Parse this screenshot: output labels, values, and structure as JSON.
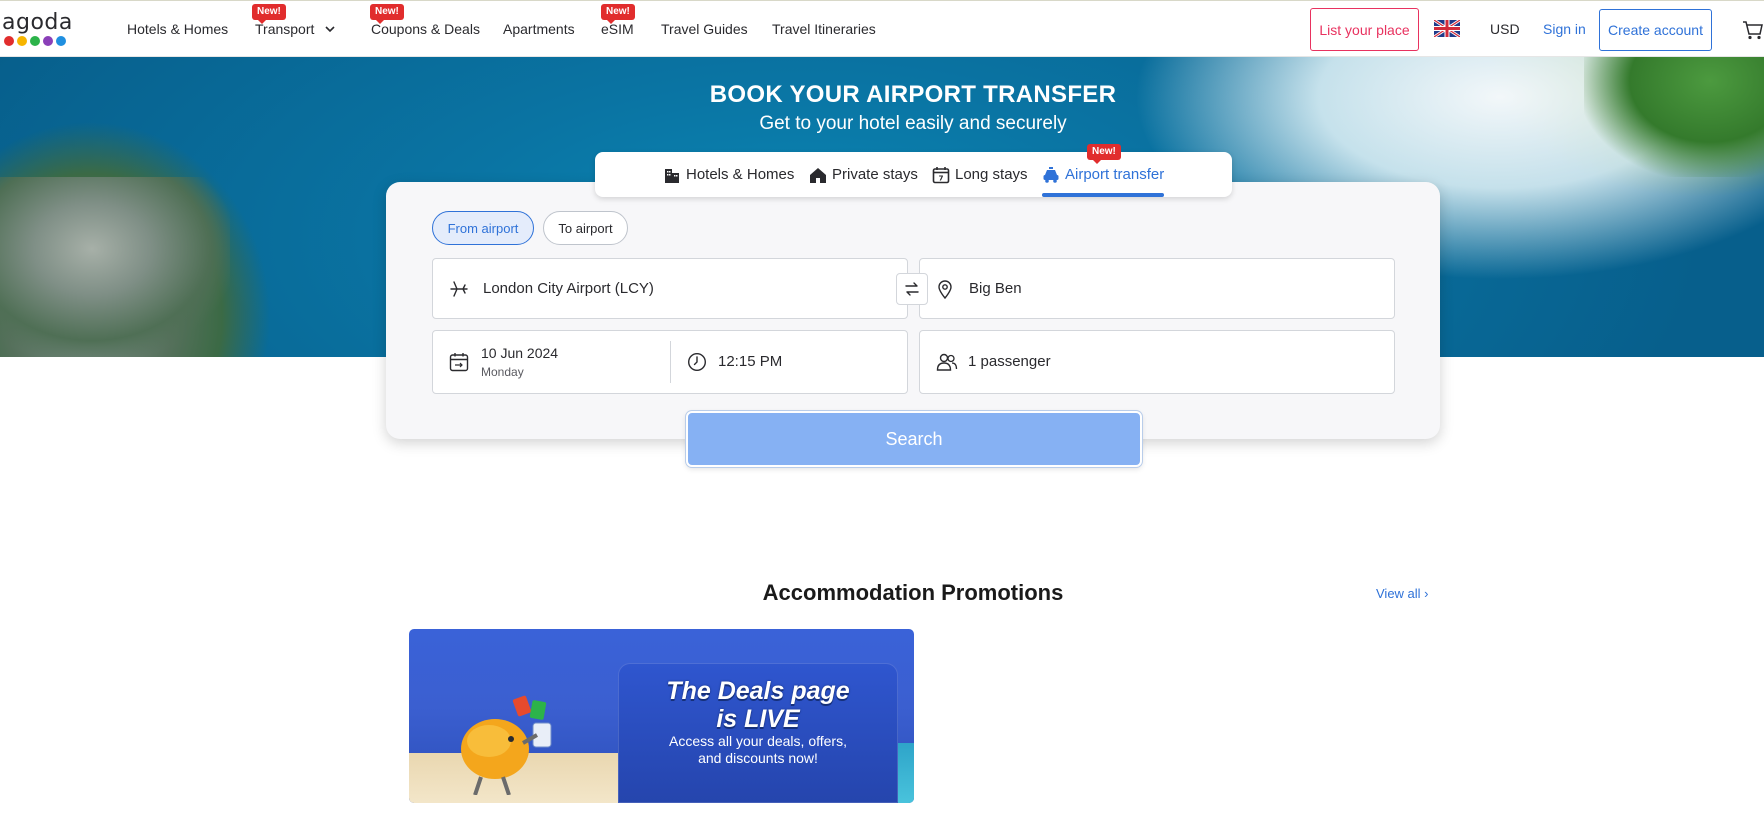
{
  "brand": {
    "name": "agoda",
    "dot_colors": [
      "#e12d2d",
      "#f7b500",
      "#2cb34a",
      "#8a3fb8",
      "#1f8fe0"
    ]
  },
  "nav": {
    "items": [
      {
        "label": "Hotels & Homes",
        "badge": ""
      },
      {
        "label": "Transport",
        "badge": "New!"
      },
      {
        "label": "Coupons & Deals",
        "badge": "New!"
      },
      {
        "label": "Apartments",
        "badge": ""
      },
      {
        "label": "eSIM",
        "badge": "New!"
      },
      {
        "label": "Travel Guides",
        "badge": ""
      },
      {
        "label": "Travel Itineraries",
        "badge": ""
      }
    ],
    "list_place": "List your place",
    "currency": "USD",
    "sign_in": "Sign in",
    "create_account": "Create account"
  },
  "hero": {
    "title": "BOOK YOUR AIRPORT TRANSFER",
    "subtitle": "Get to your hotel easily and securely"
  },
  "product_tabs": [
    {
      "label": "Hotels & Homes",
      "icon": "building-icon",
      "active": false
    },
    {
      "label": "Private stays",
      "icon": "house-icon",
      "active": false
    },
    {
      "label": "Long stays",
      "icon": "calendar-icon",
      "active": false
    },
    {
      "label": "Airport transfer",
      "icon": "car-icon",
      "active": true,
      "badge": "New!"
    }
  ],
  "search": {
    "direction_options": [
      "From airport",
      "To airport"
    ],
    "selected_direction": "From airport",
    "from": "London City Airport (LCY)",
    "to": "Big Ben",
    "date": "10 Jun 2024",
    "weekday": "Monday",
    "time": "12:15 PM",
    "passengers": "1 passenger",
    "button": "Search"
  },
  "promotions": {
    "title": "Accommodation Promotions",
    "view_all": "View all ›",
    "banner": {
      "headline_line1": "The Deals page",
      "headline_line2": "is LIVE",
      "body_line1": "Access all your deals, offers,",
      "body_line2": "and discounts now!"
    }
  },
  "colors": {
    "accent": "#2f72d8",
    "brand_pink": "#e8325f",
    "badge_red": "#e12d2d",
    "search_button": "#86b1f3"
  }
}
